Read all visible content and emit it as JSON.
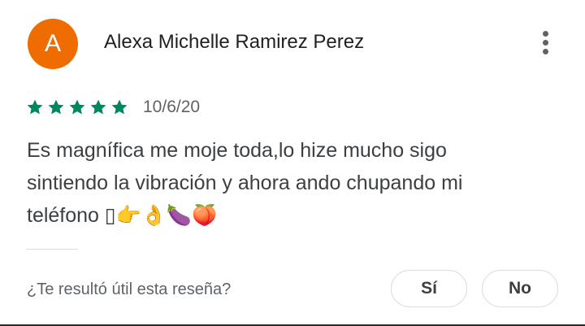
{
  "review": {
    "avatar_letter": "A",
    "avatar_color": "#ef6c00",
    "author_name": "Alexa Michelle Ramirez Perez",
    "menu_icon": "more-vert-icon",
    "rating": 5,
    "rating_max": 5,
    "star_color": "#01875f",
    "date": "10/6/20",
    "text_lines": [
      "Es magnífica me moje toda,lo hize mucho sigo",
      "sintiendo la vibración y ahora ando chupando mi",
      "teléfono ▯👉👌🍆🍑"
    ]
  },
  "feedback": {
    "question": "¿Te resultó útil esta reseña?",
    "yes_label": "Sí",
    "no_label": "No"
  }
}
